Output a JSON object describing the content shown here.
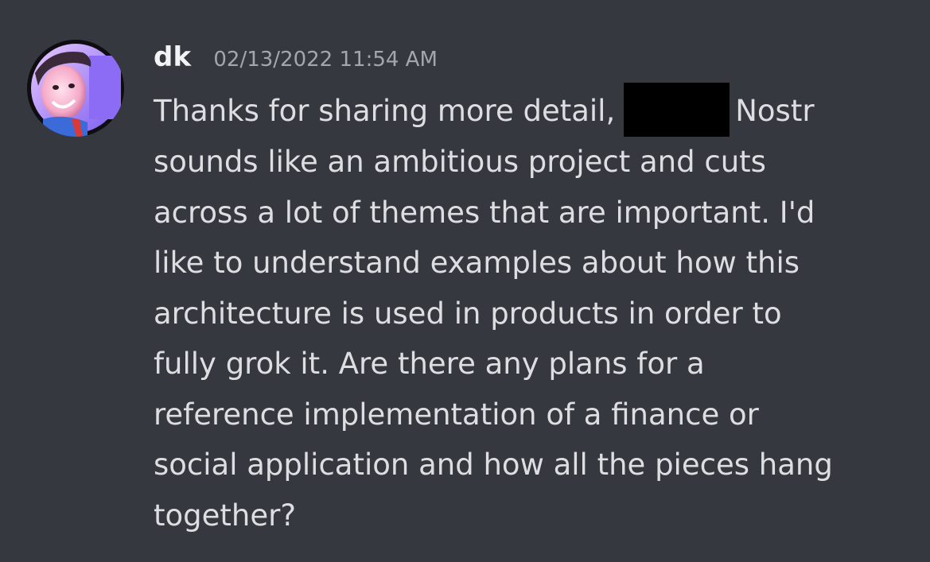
{
  "message": {
    "author": "dk",
    "timestamp": "02/13/2022 11:54 AM",
    "avatar_icon": "profile-photo-avatar",
    "redaction_color": "#000000",
    "lines": [
      {
        "before": "Thanks for sharing more detail,",
        "after": "Nostr"
      },
      "sounds like an ambitious project and cuts",
      "across a lot of themes that are important. I'd",
      "like to understand examples about how this",
      "architecture is used in products in order to",
      "fully grok it. Are there any plans for a",
      "reference implementation of a finance or",
      "social application and how all the pieces hang",
      "together?"
    ]
  },
  "colors": {
    "background": "#36383f",
    "username": "#f2f3f5",
    "timestamp": "#a3a6ad",
    "text": "#dcdee1"
  }
}
